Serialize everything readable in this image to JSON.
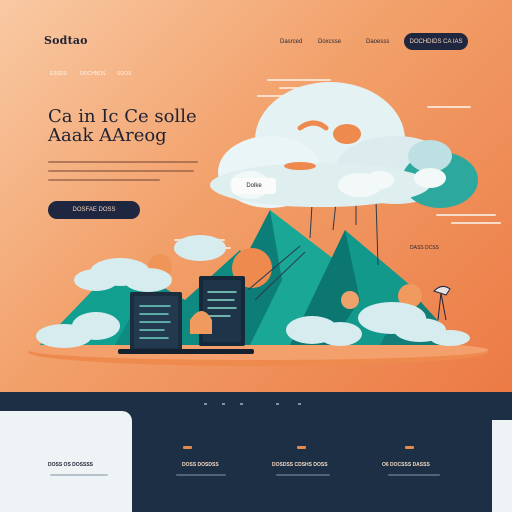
{
  "brand": {
    "name": "Sodtao"
  },
  "nav": {
    "links": [
      "Dasrced",
      "Doxcsse",
      "Daoesss"
    ],
    "cta": "DOCHDIDS CA IAS"
  },
  "subnav": [
    "ESSDS",
    "DOCHNDS",
    "SOOS"
  ],
  "hero": {
    "headline_line1": "Ca in Ic Ce solle",
    "headline_line2": "Aaak AAreog",
    "cta_label": "DOSFAE DOSS",
    "cloud_label": "Dolke",
    "side_label": "DASS DCSS"
  },
  "colors": {
    "accent": "#ec7a45",
    "navy": "#1f2740",
    "teal": "#1fa595",
    "footer": "#1c2f44"
  },
  "footer": {
    "columns": [
      {
        "title": "DOSS OS DOSSSS"
      },
      {
        "title": "DOSS DOSDSS"
      },
      {
        "title": "DOSDSS CDSHS DOSS"
      },
      {
        "title": "O6 DOCSSS DASSS"
      }
    ]
  }
}
